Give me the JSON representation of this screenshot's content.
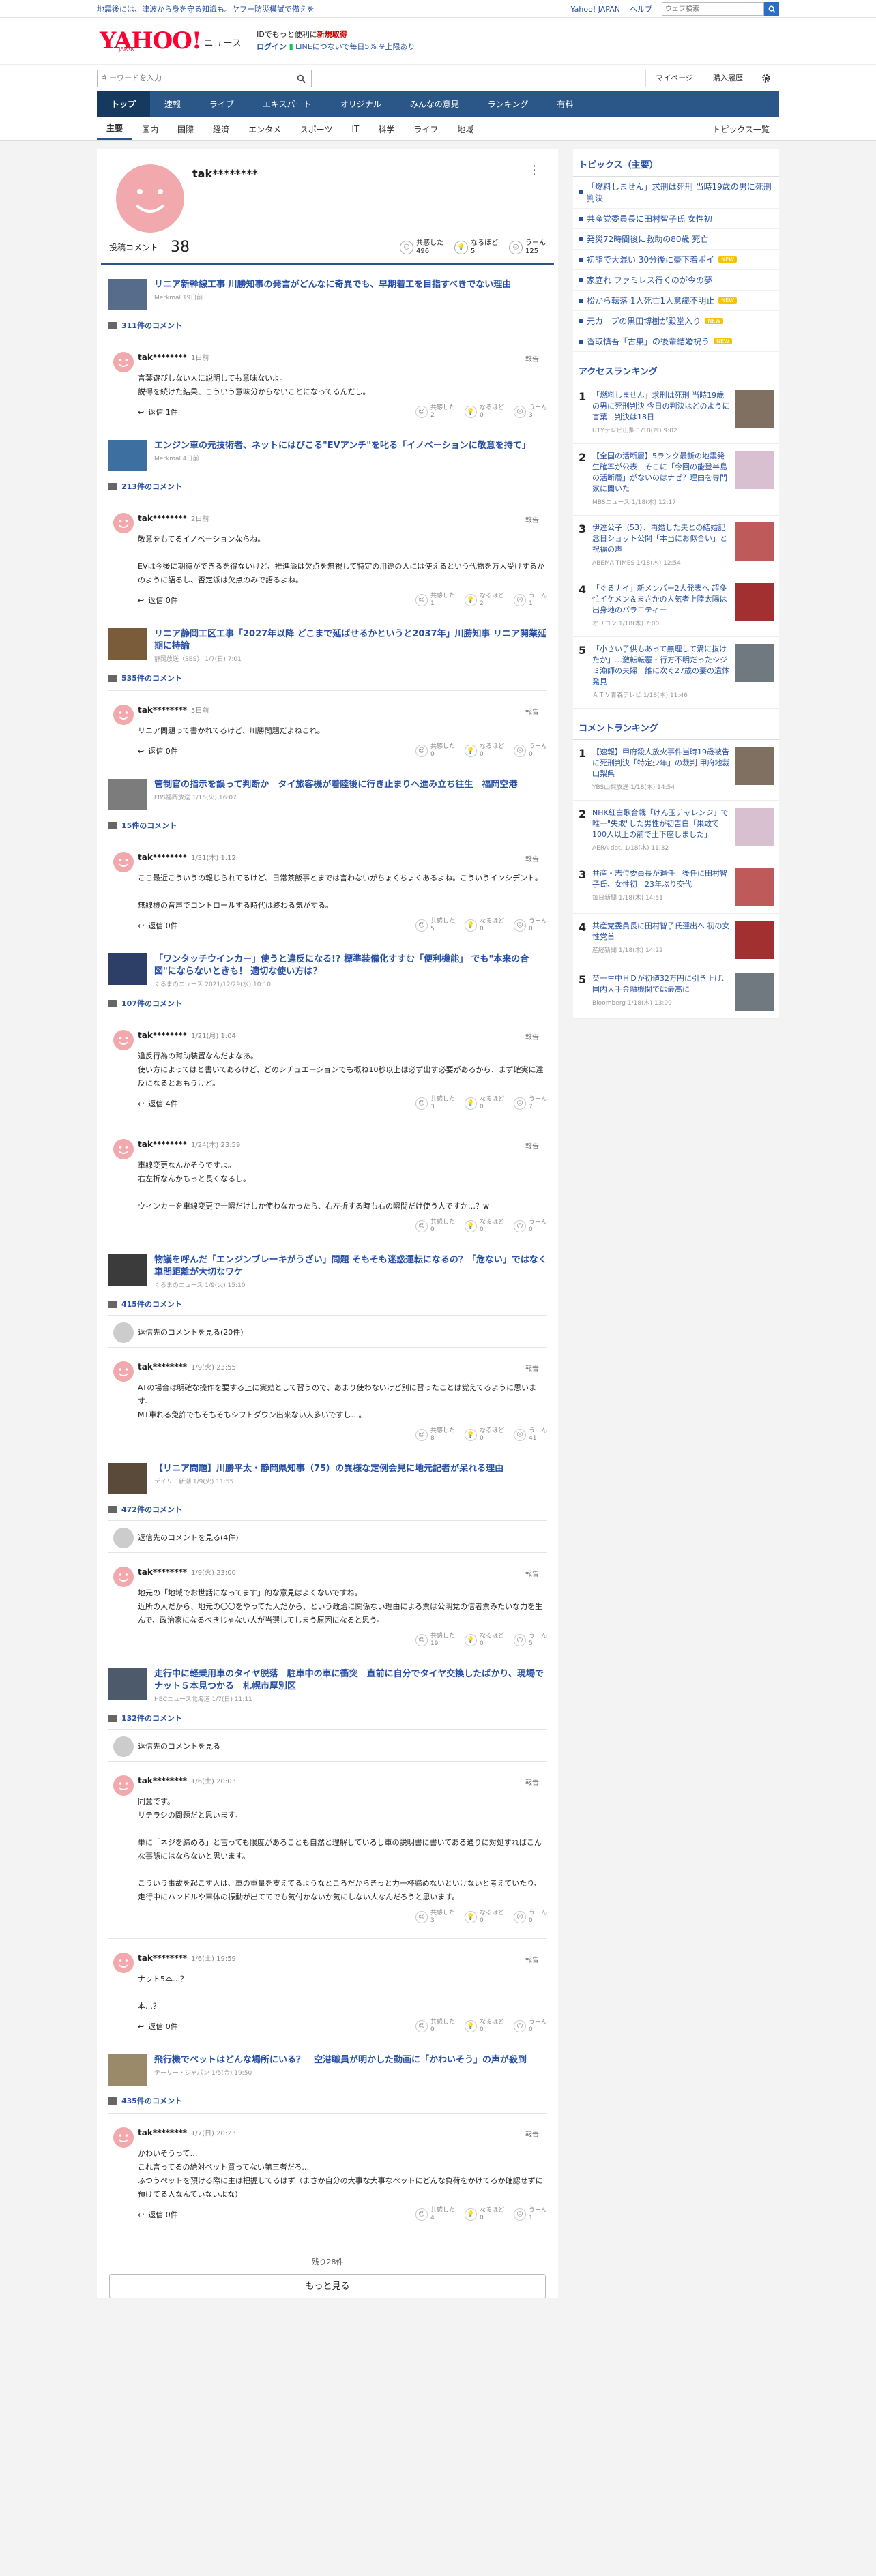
{
  "topbar": {
    "notice": "地震後には、津波から身を守る知識も。ヤフー防災模試で備えを",
    "yahoo_japan": "Yahoo! JAPAN",
    "help": "ヘルプ",
    "search_placeholder": "ウェブ検索"
  },
  "header": {
    "logo": "YAHOO!",
    "logo_sub": "JAPAN",
    "section": "ニュース",
    "promo1": "IDでもっと便利に",
    "promo1b": "新規取得",
    "login": "ログイン",
    "promo2": "LINEにつないで毎日5% ※上限あり"
  },
  "search": {
    "placeholder": "キーワードを入力",
    "mypage": "マイページ",
    "history": "購入履歴"
  },
  "nav": [
    "トップ",
    "速報",
    "ライブ",
    "エキスパート",
    "オリジナル",
    "みんなの意見",
    "ランキング",
    "有料"
  ],
  "subnav": [
    "主要",
    "国内",
    "国際",
    "経済",
    "エンタメ",
    "スポーツ",
    "IT",
    "科学",
    "ライフ",
    "地域"
  ],
  "subnav_all": "トピックス一覧",
  "profile": {
    "name": "tak********",
    "count_label": "投稿コメント",
    "count": "38",
    "reacts": [
      {
        "label": "共感した",
        "n": "496"
      },
      {
        "label": "なるほど",
        "n": "5"
      },
      {
        "label": "うーん",
        "n": "125"
      }
    ]
  },
  "articles": [
    {
      "title": "リニア新幹線工事 川勝知事の発言がどんなに奇異でも、早期着工を目指すべきでない理由",
      "src": "Merkmal 19日前",
      "ccount": "311件のコメント",
      "showreplies": "",
      "comments": [
        {
          "name": "tak********",
          "time": "1日前",
          "text": "言葉遊びしない人に説明しても意味ないよ。\n説得を続けた結果、こういう意味分からないことになってるんだし。",
          "reply": "返信 1件",
          "r": [
            "2",
            "0",
            "3"
          ]
        }
      ]
    },
    {
      "title": "エンジン車の元技術者、ネットにはびこる\"EVアンチ\"を叱る「イノベーションに敬意を持て」",
      "src": "Merkmal 4日前",
      "ccount": "213件のコメント",
      "showreplies": "",
      "comments": [
        {
          "name": "tak********",
          "time": "2日前",
          "text": "敬意をもてるイノベーションならね。\n\nEVは今後に期待ができるを得ないけど、推進派は欠点を無視して特定の用途の人には使えるという代物を万人受けするかのように語るし、否定派は欠点のみで語るよね。",
          "reply": "返信 0件",
          "r": [
            "1",
            "2",
            "1"
          ]
        }
      ]
    },
    {
      "title": "リニア静岡工区工事「2027年以降 どこまで延ばせるかというと2037年」川勝知事 リニア開業延期に持論",
      "src": "静岡放送（SBS） 1/7(日) 7:01",
      "ccount": "535件のコメント",
      "showreplies": "",
      "comments": [
        {
          "name": "tak********",
          "time": "5日前",
          "text": "リニア問題って書かれてるけど、川勝問題だよねこれ。",
          "reply": "返信 0件",
          "r": [
            "0",
            "0",
            "0"
          ]
        }
      ]
    },
    {
      "title": "管制官の指示を誤って判断か　タイ旅客機が着陸後に行き止まりへ進み立ち往生　福岡空港",
      "src": "FBS福岡放送 1/16(火) 16:07",
      "ccount": "15件のコメント",
      "showreplies": "",
      "comments": [
        {
          "name": "tak********",
          "time": "1/31(木) 1:12",
          "text": "ここ最近こういうの報じられてるけど、日常茶飯事とまでは言わないがちょくちょくあるよね。こういうインシデント。\n\n無線機の音声でコントロールする時代は終わる気がする。",
          "reply": "返信 0件",
          "r": [
            "5",
            "0",
            "0"
          ]
        }
      ]
    },
    {
      "title": "「ワンタッチウインカー」使うと違反になる!? 標準装備化すすむ「便利機能」 でも\"本来の合図\"にならないときも！ 適切な使い方は？",
      "src": "くるまのニュース 2021/12/29(水) 10:10",
      "ccount": "107件のコメント",
      "showreplies": "",
      "comments": [
        {
          "name": "tak********",
          "time": "1/21(月) 1:04",
          "text": "違反行為の幇助装置なんだよなあ。\n使い方によってはと書いてあるけど、どのシチュエーションでも概ね10秒以上は必ず出す必要があるから、まず確実に違反になるとおもうけど。",
          "reply": "返信 4件",
          "r": [
            "3",
            "0",
            "7"
          ]
        },
        {
          "name": "tak********",
          "time": "1/24(木) 23:59",
          "text": "車線変更なんかそうですよ。\n右左折なんかもっと長くなるし。\n\nウィンカーを車線変更で一瞬だけしか使わなかったら、右左折する時も右の瞬間だけ使う人ですか…？w",
          "reply": "",
          "r": [
            "0",
            "0",
            "0"
          ]
        }
      ]
    },
    {
      "title": "物議を呼んだ「エンジンブレーキがうざい」問題 そもそも迷惑運転になるの？「危ない」ではなく車間距離が大切なワケ",
      "src": "くるまのニュース 1/9(火) 15:10",
      "ccount": "415件のコメント",
      "showreplies": "返信先のコメントを見る(20件)",
      "comments": [
        {
          "name": "tak********",
          "time": "1/9(火) 23:55",
          "text": "ATの場合は明確な操作を要する上に実効として習うので、あまり使わないけど別に習ったことは覚えてるように思います。\nMT車れる免許でもそもそもシフトダウン出来ない人多いですし…。",
          "reply": "",
          "r": [
            "8",
            "0",
            "41"
          ]
        }
      ]
    },
    {
      "title": "【リニア問題】川勝平太・静岡県知事（75）の異様な定例会見に地元記者が呆れる理由",
      "src": "デイリー新潮 1/9(火) 11:55",
      "ccount": "472件のコメント",
      "showreplies": "返信先のコメントを見る(4件)",
      "comments": [
        {
          "name": "tak********",
          "time": "1/9(火) 23:00",
          "text": "地元の「地域でお世話になってます」的な意見はよくないですね。\n近所の人だから、地元の〇〇をやってた人だから、という政治に関係ない理由による票は公明党の信者票みたいな力を生んで、政治家になるべきじゃない人が当選してしまう原因になると思う。",
          "reply": "",
          "r": [
            "19",
            "0",
            "5"
          ]
        }
      ]
    },
    {
      "title": "走行中に軽乗用車のタイヤ脱落　駐車中の車に衝突　直前に自分でタイヤ交換したばかり、現場でナット５本見つかる　札幌市厚別区",
      "src": "HBCニュース北海道 1/7(日) 11:11",
      "ccount": "132件のコメント",
      "showreplies": "返信先のコメントを見る",
      "comments": [
        {
          "name": "tak********",
          "time": "1/6(土) 20:03",
          "text": "同意です。\nリテラシの問題だと思います。\n\n単に「ネジを締める」と言っても限度があることも自然と理解しているし車の説明書に書いてある通りに対処すればこんな事態にはならないと思います。\n\nこういう事故を起こす人は、車の重量を支えてるようなところだからきっと力一杯締めないといけないと考えていたり、走行中にハンドルや車体の振動が出ててでも気付かないか気にしない人なんだろうと思います。",
          "reply": "",
          "r": [
            "3",
            "0",
            "0"
          ]
        },
        {
          "name": "tak********",
          "time": "1/6(土) 19:59",
          "text": "ナット5本…？\n\n本…？",
          "reply": "返信 0件",
          "r": [
            "0",
            "0",
            "0"
          ]
        }
      ]
    },
    {
      "title": "飛行機でペットはどんな場所にいる？　空港職員が明かした動画に「かわいそう」の声が殺到",
      "src": "テーリー・ジャパン 1/5(金) 19:50",
      "ccount": "435件のコメント",
      "showreplies": "",
      "comments": [
        {
          "name": "tak********",
          "time": "1/7(日) 20:23",
          "text": "かわいそうって…\nこれ言ってるの絶対ペット買ってない第三者だろ…\nふつうペットを預ける際に主は把握してるはず（まさか自分の大事な大事なペットにどんな負荷をかけてるか確認せずに預けてる人なんていないよな）",
          "reply": "返信 0件",
          "r": [
            "4",
            "0",
            "1"
          ]
        }
      ]
    }
  ],
  "bottom": {
    "remaining": "残り28件",
    "more": "もっと見る"
  },
  "topics": {
    "title": "トピックス（主要）",
    "items": [
      {
        "t": "「燃料しません」求刑は死刑 当時19歳の男に死刑判決",
        "b": ""
      },
      {
        "t": "共産党委員長に田村智子氏 女性初",
        "b": ""
      },
      {
        "t": "発災72時間後に救助の80歳 死亡",
        "b": ""
      },
      {
        "t": "初詣で大混い 30分後に豪下着ポイ",
        "b": "NEW"
      },
      {
        "t": "家庭れ ファミレス行くのが今の夢",
        "b": ""
      },
      {
        "t": "松から転落 1人死亡1人意識不明止",
        "b": "NEW"
      },
      {
        "t": "元カープの黒田博樹が殿堂入り",
        "b": "NEW"
      },
      {
        "t": "香取慎吾「古巣」の後輩結婚祝う",
        "b": "NEW"
      }
    ]
  },
  "access_ranking": {
    "title": "アクセスランキング",
    "items": [
      {
        "n": "1",
        "t": "「燃料しません」求刑は死刑 当時19歳の男に死刑判決 今日の判決はどのように言葉　判決は18日",
        "s": "UTYテレビ山梨 1/18(木) 9:02"
      },
      {
        "n": "2",
        "t": "【全国の活断層】5ランク最新の地震発生確率が公表　そこに「今回の能登半島の活断層」がないのはナゼ？理由を専門家に聞いた",
        "s": "MBSニュース 1/18(木) 12:17"
      },
      {
        "n": "3",
        "t": "伊達公子（53）、再婚した夫との結婚記念日ショット公開「本当にお似合い」と祝福の声",
        "s": "ABEMA TIMES 1/18(木) 12:54"
      },
      {
        "n": "4",
        "t": "「ぐるナイ」新メンバー2人発表へ 超多忙イケメン＆まさかの人気者上陸太陽は出身地のバラエティー",
        "s": "オリコン 1/18(木) 7:00"
      },
      {
        "n": "5",
        "t": "「小さい子供もあって無理して溝に抜けたか」…激転転覆・行方不明だったシジミ漁師の夫婦　誰に次ぐ27歳の妻の遺体発見",
        "s": "ＡＴＶ青森テレビ 1/18(木) 11:46"
      }
    ]
  },
  "comment_ranking": {
    "title": "コメントランキング",
    "items": [
      {
        "n": "1",
        "t": "【速報】甲府殺人放火事件当時19歳被告に死刑判決「特定少年」の裁判 甲府地裁 山梨県",
        "s": "YBS山梨放送 1/18(木) 14:54"
      },
      {
        "n": "2",
        "t": "NHK紅白歌合戦「けん玉チャレンジ」で唯一\"失敗\"した男性が初告白「果敢で100人以上の前で土下座しました」",
        "s": "AERA dot. 1/18(木) 11:32"
      },
      {
        "n": "3",
        "t": "共産・志位委員長が退任　後任に田村智子氏、女性初　23年ぶり交代",
        "s": "毎日新聞 1/18(木) 14:51"
      },
      {
        "n": "4",
        "t": "共産党委員長に田村智子氏選出へ 初の女性党首",
        "s": "産経新聞 1/18(木) 14:22"
      },
      {
        "n": "5",
        "t": "英一生中ＨＤが初値32万円に引き上げ、国内大手金融機関では最高に",
        "s": "Bloomberg 1/18(木) 13:09"
      }
    ]
  }
}
